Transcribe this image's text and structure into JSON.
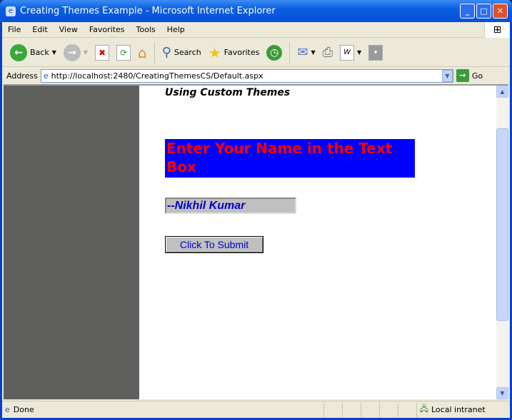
{
  "window": {
    "title": "Creating Themes Example - Microsoft Internet Explorer"
  },
  "menu": [
    "File",
    "Edit",
    "View",
    "Favorites",
    "Tools",
    "Help"
  ],
  "toolbar": {
    "back": "Back",
    "search": "Search",
    "favorites": "Favorites"
  },
  "address": {
    "label": "Address",
    "url": "http://localhost:2480/CreatingThemesCS/Default.aspx",
    "go": "Go"
  },
  "page": {
    "heading": "Using Custom Themes",
    "banner": "Enter Your Name in the Text Box",
    "name_value": "--Nikhil Kumar",
    "submit_label": "Click To Submit"
  },
  "status": {
    "text": "Done",
    "zone": "Local intranet"
  },
  "colors": {
    "banner_bg": "#0000ff",
    "banner_text": "#ff0000",
    "input_text": "#0000cc",
    "side_panel": "#5f605d"
  }
}
